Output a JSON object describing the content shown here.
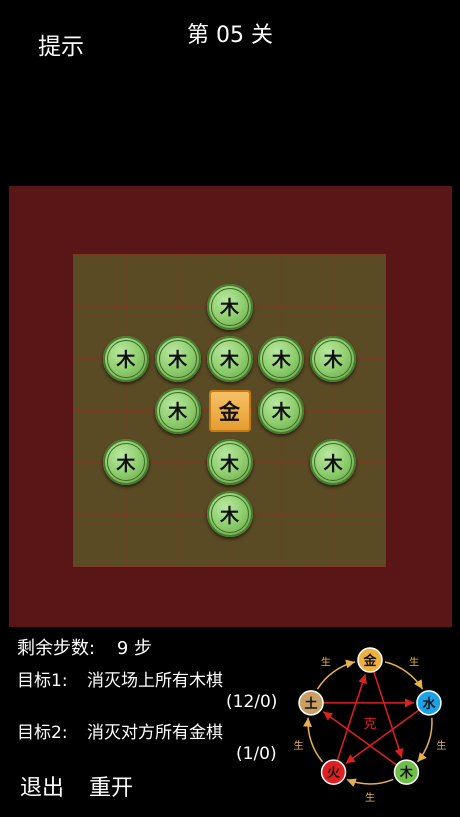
{
  "header": {
    "hint_label": "提示",
    "level_title": "第 05 关"
  },
  "board": {
    "grid_cols": 6,
    "grid_rows": 6,
    "pieces": [
      {
        "label": "木",
        "col": 3,
        "row": 1
      },
      {
        "label": "木",
        "col": 1,
        "row": 2
      },
      {
        "label": "木",
        "col": 2,
        "row": 2
      },
      {
        "label": "木",
        "col": 3,
        "row": 2
      },
      {
        "label": "木",
        "col": 4,
        "row": 2
      },
      {
        "label": "木",
        "col": 5,
        "row": 2
      },
      {
        "label": "木",
        "col": 2,
        "row": 3
      },
      {
        "label": "木",
        "col": 4,
        "row": 3
      },
      {
        "label": "木",
        "col": 1,
        "row": 4
      },
      {
        "label": "木",
        "col": 3,
        "row": 4
      },
      {
        "label": "木",
        "col": 5,
        "row": 4
      },
      {
        "label": "木",
        "col": 3,
        "row": 5
      }
    ],
    "player": {
      "label": "金",
      "col": 3,
      "row": 3
    }
  },
  "status": {
    "steps_label": "剩余步数:",
    "steps_value": "9 步",
    "goal1_label": "目标1:",
    "goal1_text": "消灭场上所有木棋",
    "goal1_progress": "(12/0)",
    "goal2_label": "目标2:",
    "goal2_text": "消灭对方所有金棋",
    "goal2_progress": "(1/0)"
  },
  "actions": {
    "exit_label": "退出",
    "restart_label": "重开"
  },
  "wuxing": {
    "elements": [
      {
        "label": "金",
        "color": "#f0b040"
      },
      {
        "label": "水",
        "color": "#1aa3e8"
      },
      {
        "label": "木",
        "color": "#6fbf4a"
      },
      {
        "label": "火",
        "color": "#e02020"
      },
      {
        "label": "土",
        "color": "#c8a064"
      }
    ],
    "sheng_label": "生",
    "ke_label": "克"
  }
}
